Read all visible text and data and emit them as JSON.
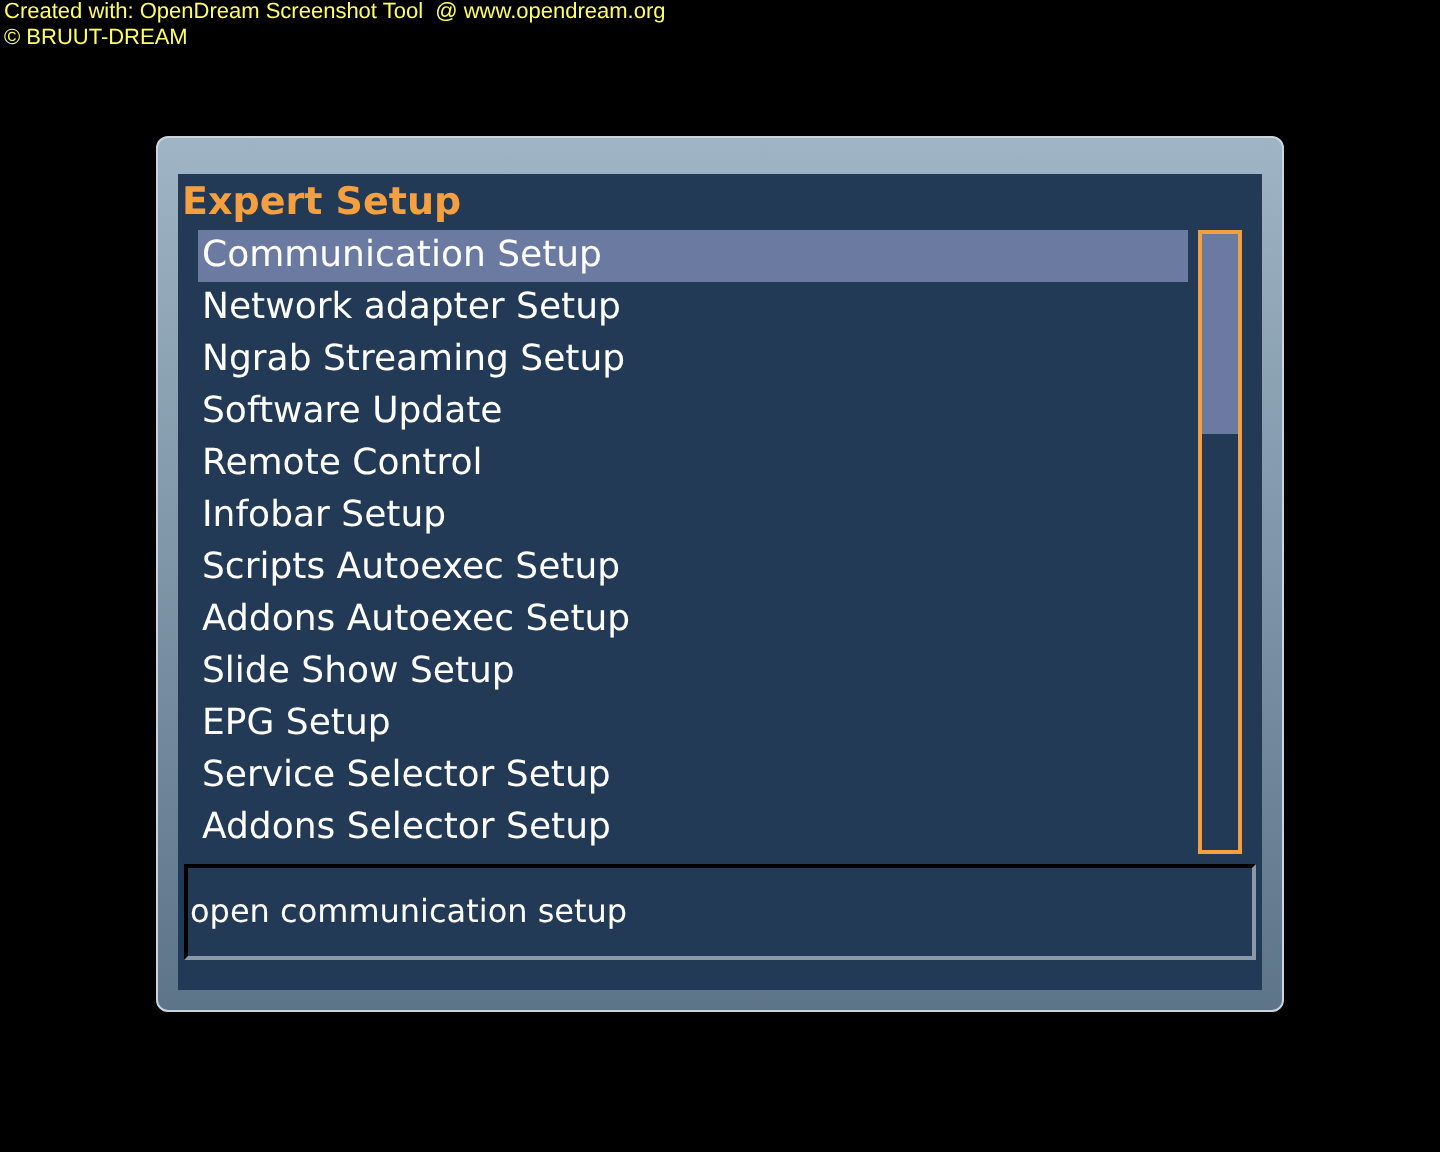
{
  "credits": [
    "Created with: OpenDream Screenshot Tool  @ www.opendream.org",
    "© BRUUT-DREAM"
  ],
  "window": {
    "title": "Expert Setup"
  },
  "menu": {
    "items": [
      {
        "label": "Communication Setup",
        "selected": true
      },
      {
        "label": "Network adapter Setup",
        "selected": false
      },
      {
        "label": "Ngrab Streaming Setup",
        "selected": false
      },
      {
        "label": "Software Update",
        "selected": false
      },
      {
        "label": "Remote Control",
        "selected": false
      },
      {
        "label": "Infobar Setup",
        "selected": false
      },
      {
        "label": "Scripts Autoexec Setup",
        "selected": false
      },
      {
        "label": "Addons Autoexec Setup",
        "selected": false
      },
      {
        "label": "Slide Show Setup",
        "selected": false
      },
      {
        "label": "EPG Setup",
        "selected": false
      },
      {
        "label": "Service Selector Setup",
        "selected": false
      },
      {
        "label": "Addons Selector Setup",
        "selected": false
      }
    ]
  },
  "status_bar": {
    "text": "open communication setup"
  }
}
